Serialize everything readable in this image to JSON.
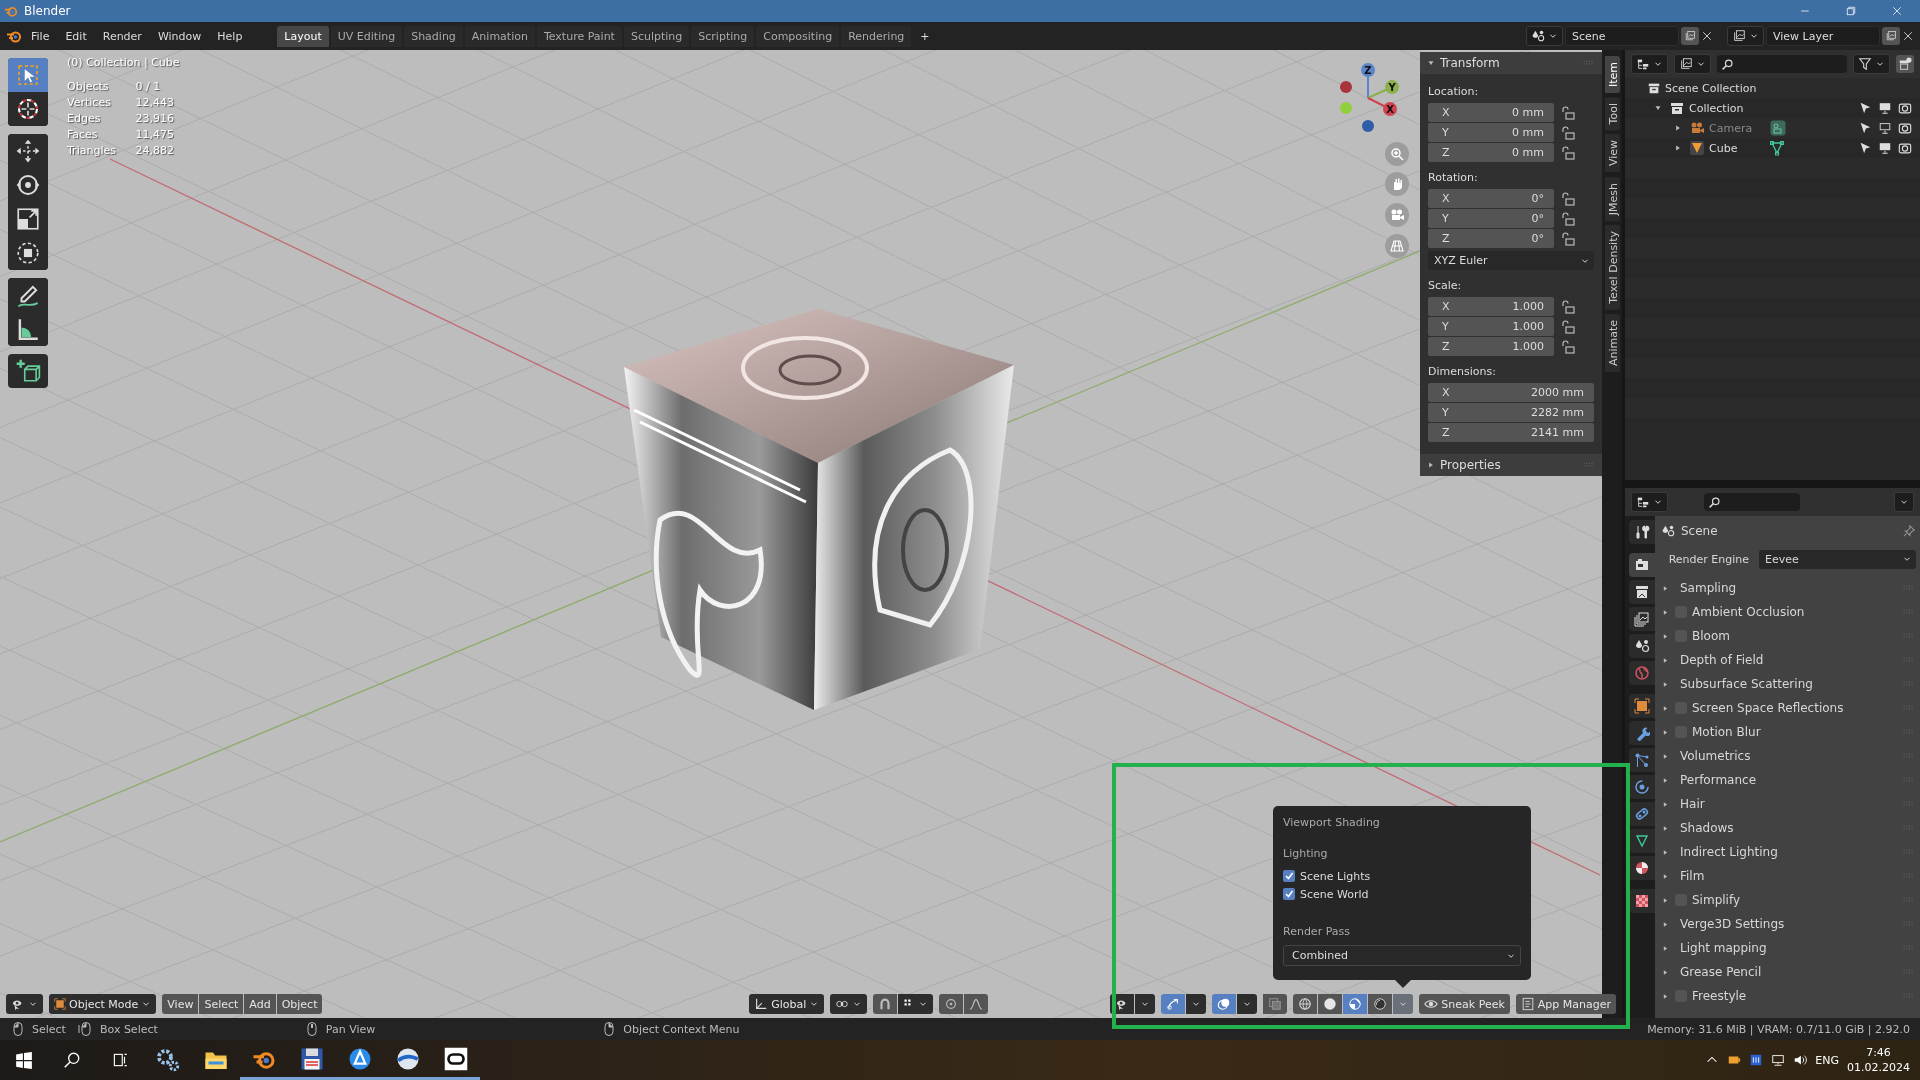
{
  "window": {
    "title": "Blender"
  },
  "menus": [
    "File",
    "Edit",
    "Render",
    "Window",
    "Help"
  ],
  "workspaces": [
    {
      "label": "Layout",
      "selected": true
    },
    {
      "label": "UV Editing",
      "selected": false
    },
    {
      "label": "Shading",
      "selected": false
    },
    {
      "label": "Animation",
      "selected": false
    },
    {
      "label": "Texture Paint",
      "selected": false
    },
    {
      "label": "Sculpting",
      "selected": false
    },
    {
      "label": "Scripting",
      "selected": false
    },
    {
      "label": "Compositing",
      "selected": false
    },
    {
      "label": "Rendering",
      "selected": false
    }
  ],
  "add_workspace": "+",
  "scene": "Scene",
  "view_layer": "View Layer",
  "viewport": {
    "object_info": "(0) Collection | Cube",
    "stats": [
      {
        "label": "Objects",
        "value": "0 / 1"
      },
      {
        "label": "Vertices",
        "value": "12,443"
      },
      {
        "label": "Edges",
        "value": "23,916"
      },
      {
        "label": "Faces",
        "value": "11,475"
      },
      {
        "label": "Triangles",
        "value": "24,882"
      }
    ],
    "tools": [
      {
        "kind": "select",
        "selected": true
      },
      {
        "kind": "cursor",
        "selected": false
      },
      {
        "kind": "move",
        "selected": false
      },
      {
        "kind": "rotate",
        "selected": false
      },
      {
        "kind": "scale",
        "selected": false
      },
      {
        "kind": "transform",
        "selected": false
      },
      {
        "kind": "annotate",
        "selected": false
      },
      {
        "kind": "measure",
        "selected": false
      },
      {
        "kind": "add-cube",
        "selected": false
      }
    ],
    "gizmo_axes": [
      "Z",
      "Y",
      "X"
    ],
    "mode": "Object Mode",
    "header_menus": [
      "View",
      "Select",
      "Add",
      "Object"
    ],
    "orientation": "Global",
    "toggles": [
      {
        "kind": "visibility",
        "on": false
      },
      {
        "kind": "gizmos",
        "on": true
      },
      {
        "kind": "overlays",
        "on": true
      },
      {
        "kind": "xray",
        "on": false
      }
    ],
    "shading_modes": [
      {
        "kind": "wireframe",
        "selected": false
      },
      {
        "kind": "solid",
        "selected": false
      },
      {
        "kind": "material",
        "selected": true
      },
      {
        "kind": "rendered",
        "selected": false
      }
    ],
    "addon_buttons": [
      {
        "kind": "eye",
        "label": "Sneak Peek"
      },
      {
        "kind": "document",
        "label": "App Manager"
      }
    ],
    "shading_popover": {
      "title": "Viewport Shading",
      "lighting_label": "Lighting",
      "options": [
        {
          "label": "Scene Lights",
          "checked": true
        },
        {
          "label": "Scene World",
          "checked": true
        }
      ],
      "render_pass_label": "Render Pass",
      "render_pass": "Combined"
    }
  },
  "sidebar": {
    "tabs": [
      {
        "label": "Item",
        "selected": true
      },
      {
        "label": "Tool",
        "selected": false
      },
      {
        "label": "View",
        "selected": false
      },
      {
        "label": "JMesh",
        "selected": false
      },
      {
        "label": "Texel Density",
        "selected": false
      },
      {
        "label": "Animate",
        "selected": false
      }
    ],
    "transform": {
      "title": "Transform",
      "expanded": true,
      "groups": [
        {
          "kind": "vector",
          "label": "Location:",
          "locks": true,
          "fields": [
            {
              "axis": "X",
              "value": "0 mm"
            },
            {
              "axis": "Y",
              "value": "0 mm"
            },
            {
              "axis": "Z",
              "value": "0 mm"
            }
          ]
        },
        {
          "kind": "vector",
          "label": "Rotation:",
          "locks": true,
          "fields": [
            {
              "axis": "X",
              "value": "0°"
            },
            {
              "axis": "Y",
              "value": "0°"
            },
            {
              "axis": "Z",
              "value": "0°"
            }
          ]
        },
        {
          "kind": "dropdown",
          "value": "XYZ Euler"
        },
        {
          "kind": "vector",
          "label": "Scale:",
          "locks": true,
          "fields": [
            {
              "axis": "X",
              "value": "1.000"
            },
            {
              "axis": "Y",
              "value": "1.000"
            },
            {
              "axis": "Z",
              "value": "1.000"
            }
          ]
        },
        {
          "kind": "vector",
          "label": "Dimensions:",
          "locks": false,
          "fields": [
            {
              "axis": "X",
              "value": "2000 mm"
            },
            {
              "axis": "Y",
              "value": "2282 mm"
            },
            {
              "axis": "Z",
              "value": "2141 mm"
            }
          ]
        }
      ]
    },
    "properties_panel": {
      "title": "Properties",
      "expanded": false
    }
  },
  "outliner": {
    "root": "Scene Collection",
    "items": [
      {
        "label": "Collection",
        "kind": "collection",
        "expanded": true,
        "hidden": false,
        "children": [
          {
            "label": "Camera",
            "kind": "camera",
            "expanded": false,
            "hidden": true
          },
          {
            "label": "Cube",
            "kind": "mesh",
            "expanded": false,
            "hidden": false
          }
        ]
      }
    ]
  },
  "properties": {
    "tabs": [
      {
        "kind": "tool",
        "selected": false
      },
      {
        "kind": "render",
        "selected": true
      },
      {
        "kind": "output",
        "selected": false
      },
      {
        "kind": "view-layer",
        "selected": false
      },
      {
        "kind": "scene",
        "selected": false
      },
      {
        "kind": "world",
        "selected": false
      },
      {
        "kind": "object",
        "selected": false
      },
      {
        "kind": "modifier",
        "selected": false
      },
      {
        "kind": "particles",
        "selected": false
      },
      {
        "kind": "physics",
        "selected": false
      },
      {
        "kind": "constraints",
        "selected": false
      },
      {
        "kind": "data",
        "selected": false
      },
      {
        "kind": "material",
        "selected": false
      },
      {
        "kind": "texture",
        "selected": false
      }
    ],
    "context": "Scene",
    "engine_label": "Render Engine",
    "engine": "Eevee",
    "panels": [
      {
        "label": "Sampling",
        "kind": "plain"
      },
      {
        "label": "Ambient Occlusion",
        "kind": "toggle",
        "checked": false
      },
      {
        "label": "Bloom",
        "kind": "toggle",
        "checked": false
      },
      {
        "label": "Depth of Field",
        "kind": "plain"
      },
      {
        "label": "Subsurface Scattering",
        "kind": "plain"
      },
      {
        "label": "Screen Space Reflections",
        "kind": "toggle",
        "checked": false
      },
      {
        "label": "Motion Blur",
        "kind": "toggle",
        "checked": false
      },
      {
        "label": "Volumetrics",
        "kind": "plain"
      },
      {
        "label": "Performance",
        "kind": "plain"
      },
      {
        "label": "Hair",
        "kind": "plain"
      },
      {
        "label": "Shadows",
        "kind": "plain"
      },
      {
        "label": "Indirect Lighting",
        "kind": "plain"
      },
      {
        "label": "Film",
        "kind": "plain"
      },
      {
        "label": "Simplify",
        "kind": "toggle",
        "checked": false
      },
      {
        "label": "Verge3D Settings",
        "kind": "plain"
      },
      {
        "label": "Light mapping",
        "kind": "plain"
      },
      {
        "label": "Grease Pencil",
        "kind": "plain"
      },
      {
        "label": "Freestyle",
        "kind": "toggle",
        "checked": false
      }
    ]
  },
  "status_bar": {
    "hints": [
      {
        "kind": "left-click",
        "label": "Select"
      },
      {
        "kind": "left-drag",
        "label": "Box Select"
      },
      {
        "kind": "middle-click",
        "label": "Pan View"
      },
      {
        "kind": "right-click",
        "label": "Object Context Menu"
      }
    ],
    "info": "Memory: 31.6 MiB | VRAM: 0.7/11.0 GiB | 2.92.0"
  },
  "taskbar": {
    "apps": [
      {
        "kind": "settings",
        "running": false
      },
      {
        "kind": "folder",
        "running": false
      },
      {
        "kind": "blender",
        "running": true
      },
      {
        "kind": "floppy",
        "running": true
      },
      {
        "kind": "vpn",
        "running": true
      },
      {
        "kind": "browser",
        "running": true
      },
      {
        "kind": "headset",
        "running": true
      }
    ],
    "language": "ENG",
    "time": "7:46",
    "date": "01.02.2024"
  }
}
